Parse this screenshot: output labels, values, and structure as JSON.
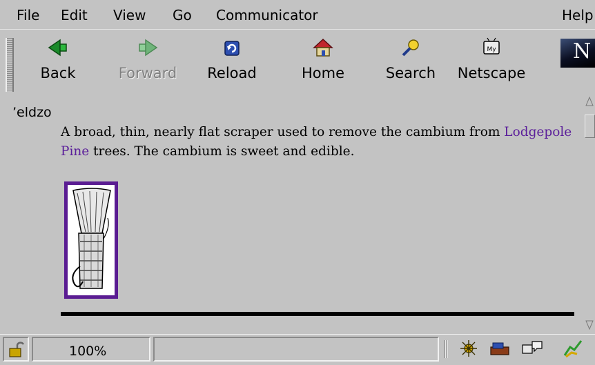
{
  "menu": [
    "File",
    "Edit",
    "View",
    "Go",
    "Communicator",
    "Help"
  ],
  "toolbar": {
    "back": "Back",
    "forward": "Forward",
    "reload": "Reload",
    "home": "Home",
    "search": "Search",
    "netscape": "Netscape",
    "my_badge": "My",
    "logo_letter": "N"
  },
  "content": {
    "term": "’eldzo",
    "definition_before": "A broad, thin, nearly flat scraper used to remove the cambium from ",
    "link_text": "Lodgepole Pine",
    "definition_after": " trees. The cambium is sweet and edible."
  },
  "status": {
    "zoom": "100%",
    "message": ""
  },
  "colors": {
    "chrome": "#c3c3c3",
    "link": "#5b1f9a",
    "image_border": "#5a1c92"
  },
  "icons": {
    "back": "back-arrow-icon",
    "forward": "forward-arrow-icon",
    "reload": "reload-icon",
    "home": "home-icon",
    "search": "search-icon",
    "netscape": "my-netscape-icon",
    "lock": "security-lock-icon",
    "navigator": "navigator-icon",
    "mail": "mail-icon",
    "discussions": "discussions-icon",
    "composer": "composer-icon"
  }
}
